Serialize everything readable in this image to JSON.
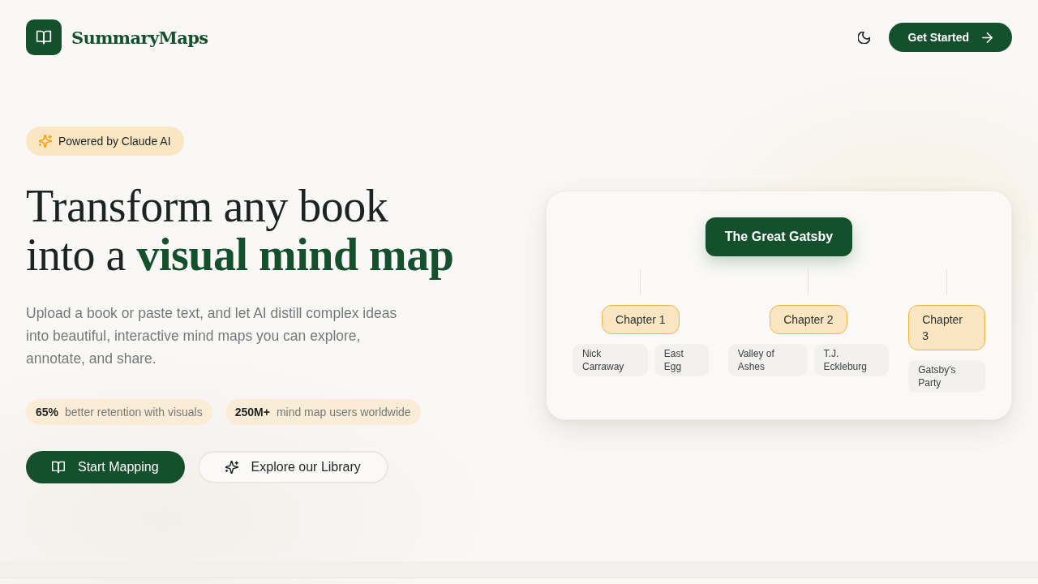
{
  "header": {
    "brand": "SummaryMaps",
    "cta": "Get Started"
  },
  "hero": {
    "badge": "Powered by Claude AI",
    "title_lines": [
      "Transform any book",
      "into a **visual mind map**"
    ],
    "description": "Upload a book or paste text, and let AI distill complex ideas into beautiful, interactive mind maps you can explore, annotate, and share.",
    "stats": [
      {
        "value": "65%",
        "label": "better retention with visuals"
      },
      {
        "value": "250M+",
        "label": "mind map users worldwide"
      }
    ],
    "buttons": [
      {
        "label": "Start Mapping",
        "kind": "primary"
      },
      {
        "label": "Explore our Library",
        "kind": "secondary"
      }
    ]
  },
  "mind_map": {
    "root": "The Great Gatsby",
    "children": [
      {
        "label": "Chapter 1",
        "children": [
          {
            "label": "Nick Carraway"
          },
          {
            "label": "East Egg"
          }
        ]
      },
      {
        "label": "Chapter 2",
        "children": [
          {
            "label": "Valley of Ashes"
          },
          {
            "label": "T.J. Eckleburg"
          }
        ]
      },
      {
        "label": "Chapter 3",
        "children": [
          {
            "label": "Gatsby's Party"
          }
        ]
      }
    ]
  }
}
